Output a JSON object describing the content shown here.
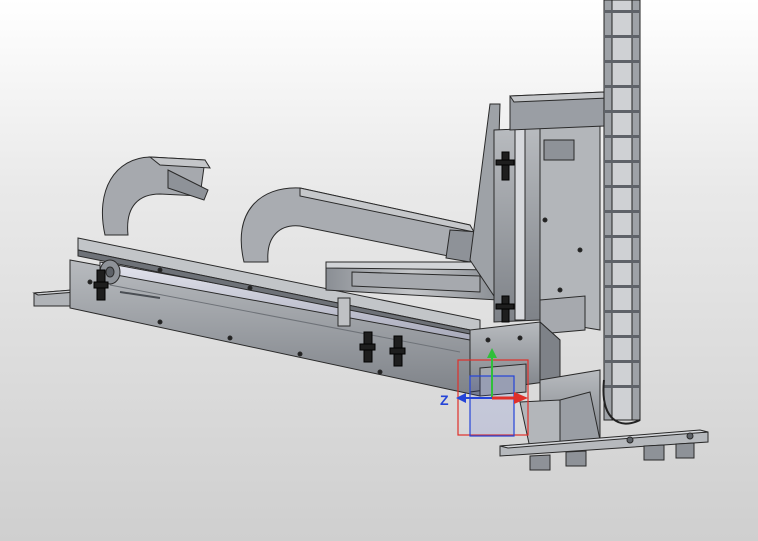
{
  "viewport": {
    "background_top": "#ffffff",
    "background_bottom": "#cfcfcf"
  },
  "model": {
    "body_color": "#9a9ea4",
    "dark_color": "#5e6268",
    "light_color": "#c9cbce",
    "clamp_color": "#1e1e1e",
    "rail_color": "#c8cad8"
  },
  "triad": {
    "z_label": "Z",
    "x_color": "#e0302a",
    "y_color": "#2fbf3a",
    "z_color": "#2444d8"
  }
}
